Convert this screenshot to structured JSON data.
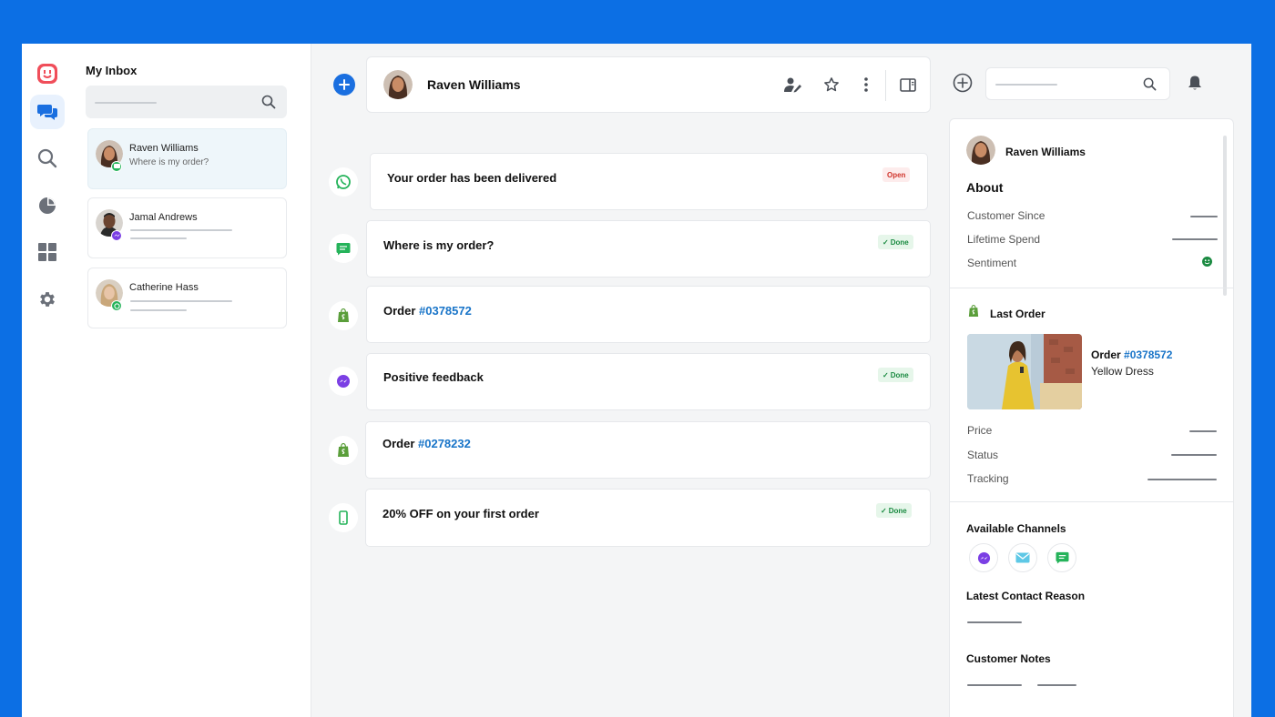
{
  "inbox": {
    "title": "My Inbox",
    "search_placeholder": "",
    "conversations": [
      {
        "name": "Raven Williams",
        "preview": "Where is my order?",
        "channel": "sms-icon"
      },
      {
        "name": "Jamal Andrews",
        "preview": "",
        "channel": "messenger-icon"
      },
      {
        "name": "Catherine Hass",
        "preview": "",
        "channel": "whatsapp-icon"
      }
    ]
  },
  "header": {
    "contact_name": "Raven Williams"
  },
  "cards": [
    {
      "title": "Your order has been delivered",
      "status": "Open",
      "channel": "whatsapp-icon"
    },
    {
      "title": "Where is my order?",
      "status": "Done",
      "channel": "sms-icon"
    },
    {
      "title": "Order ",
      "order_number": "#0378572",
      "channel": "shopify-icon"
    },
    {
      "title": "Positive feedback",
      "status": "Done",
      "channel": "messenger-icon"
    },
    {
      "title": "Order ",
      "order_number": "#0278232",
      "channel": "shopify-icon"
    },
    {
      "title": "20% OFF on your first order",
      "status": "Done",
      "channel": "phone-icon"
    }
  ],
  "right_search_placeholder": "",
  "customer": {
    "name": "Raven Williams",
    "about_title": "About",
    "about_rows": [
      "Customer Since",
      "Lifetime Spend",
      "Sentiment"
    ],
    "last_order_title": "Last Order",
    "order_prefix": "Order ",
    "order_number": "#0378572",
    "order_item": "Yellow Dress",
    "order_rows": [
      "Price",
      "Status",
      "Tracking"
    ],
    "channels_title": "Available Channels",
    "channels": [
      "messenger-icon",
      "email-icon",
      "sms-icon"
    ],
    "contact_reason_title": "Latest Contact Reason",
    "notes_title": "Customer Notes"
  },
  "colors": {
    "brand_blue": "#0c6fe4",
    "link": "#1874c8",
    "open": "#d0352c",
    "done": "#1a8a41",
    "whatsapp": "#25b35a",
    "shopify": "#5a9e3a",
    "messenger": "#7b3fe4"
  }
}
